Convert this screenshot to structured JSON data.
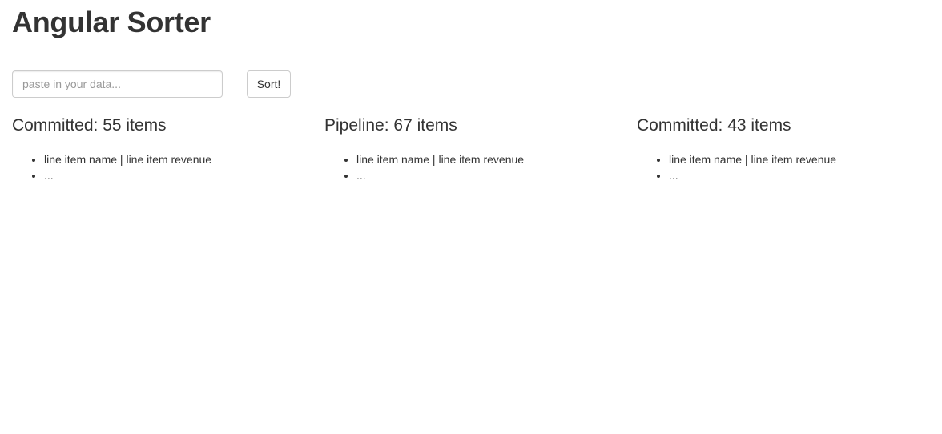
{
  "header": {
    "title": "Angular Sorter"
  },
  "controls": {
    "input_placeholder": "paste in your data...",
    "input_value": "",
    "sort_label": "Sort!"
  },
  "columns": [
    {
      "title": "Committed: 55 items",
      "items": [
        "line item name | line item revenue",
        "..."
      ]
    },
    {
      "title": "Pipeline: 67 items",
      "items": [
        "line item name | line item revenue",
        "..."
      ]
    },
    {
      "title": "Committed: 43 items",
      "items": [
        "line item name | line item revenue",
        "..."
      ]
    }
  ]
}
